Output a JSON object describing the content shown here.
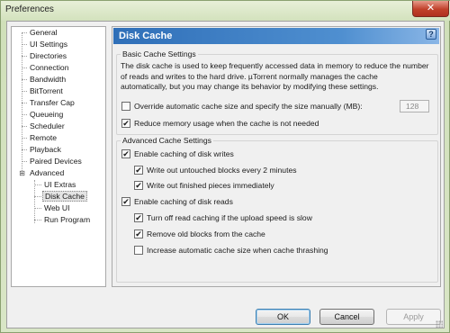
{
  "window": {
    "title": "Preferences",
    "close_glyph": "✕"
  },
  "tree": {
    "items": [
      {
        "label": "General"
      },
      {
        "label": "UI Settings"
      },
      {
        "label": "Directories"
      },
      {
        "label": "Connection"
      },
      {
        "label": "Bandwidth"
      },
      {
        "label": "BitTorrent"
      },
      {
        "label": "Transfer Cap"
      },
      {
        "label": "Queueing"
      },
      {
        "label": "Scheduler"
      },
      {
        "label": "Remote"
      },
      {
        "label": "Playback"
      },
      {
        "label": "Paired Devices"
      },
      {
        "label": "Advanced"
      }
    ],
    "children": [
      {
        "label": "UI Extras"
      },
      {
        "label": "Disk Cache"
      },
      {
        "label": "Web UI"
      },
      {
        "label": "Run Program"
      }
    ],
    "selected": "Disk Cache",
    "advanced_expander": "⊟"
  },
  "panel": {
    "header": "Disk Cache",
    "help_glyph": "?",
    "basic": {
      "title": "Basic Cache Settings",
      "description_1": "The disk cache is used to keep frequently accessed data in memory to reduce the number",
      "description_2": "of reads and writes to the hard drive. µTorrent normally manages the cache",
      "description_3": "automatically, but you may change its behavior by modifying these settings.",
      "override_label": "Override automatic cache size and specify the size manually (MB):",
      "override_checked": false,
      "size_value": "128",
      "reduce_label": "Reduce memory usage when the cache is not needed",
      "reduce_checked": true
    },
    "advanced": {
      "title": "Advanced Cache Settings",
      "enable_writes_label": "Enable caching of disk writes",
      "enable_writes_checked": true,
      "write_untouched_label": "Write out untouched blocks every 2 minutes",
      "write_untouched_checked": true,
      "write_finished_label": "Write out finished pieces immediately",
      "write_finished_checked": true,
      "enable_reads_label": "Enable caching of disk reads",
      "enable_reads_checked": true,
      "turn_off_read_label": "Turn off read caching if the upload speed is slow",
      "turn_off_read_checked": true,
      "remove_old_label": "Remove old blocks from the cache",
      "remove_old_checked": true,
      "increase_auto_label": "Increase automatic cache size when cache thrashing",
      "increase_auto_checked": false
    },
    "check_glyph": "✔"
  },
  "buttons": {
    "ok": "OK",
    "cancel": "Cancel",
    "apply": "Apply"
  }
}
